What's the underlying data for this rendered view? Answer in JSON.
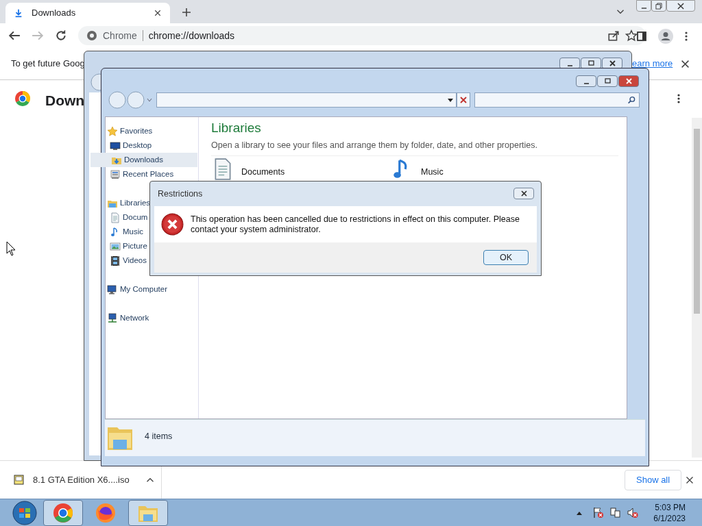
{
  "browser": {
    "tabs": [
      {
        "title": "Downloads",
        "selected": true
      }
    ],
    "address": {
      "site": "Chrome",
      "url": "chrome://downloads"
    },
    "info_bar": {
      "text": "To get future Goog",
      "link": "earn more"
    },
    "page_title": "Down",
    "download_shelf": {
      "items": [
        {
          "name": "8.1 GTA Edition X6....iso"
        }
      ],
      "show_all": "Show all"
    }
  },
  "explorer": {
    "sidebar": [
      {
        "label": "Favorites",
        "kind": "star",
        "selected": false,
        "children": [
          {
            "label": "Desktop",
            "kind": "desktop",
            "selected": false
          },
          {
            "label": "Downloads",
            "kind": "download",
            "selected": true
          },
          {
            "label": "Recent Places",
            "kind": "recent",
            "selected": false
          }
        ]
      },
      {
        "label": "Libraries",
        "kind": "library",
        "selected": false,
        "children": [
          {
            "label": "Docum",
            "kind": "document",
            "selected": false
          },
          {
            "label": "Music",
            "kind": "music",
            "selected": false
          },
          {
            "label": "Picture",
            "kind": "picture",
            "selected": false
          },
          {
            "label": "Videos",
            "kind": "video",
            "selected": false
          }
        ]
      },
      {
        "label": "My Computer",
        "kind": "computer",
        "selected": false
      },
      {
        "label": "Network",
        "kind": "network",
        "selected": false
      }
    ],
    "content": {
      "title": "Libraries",
      "description": "Open a library to see your files and arrange them by folder, date, and other properties.",
      "items": [
        {
          "name": "Documents",
          "kind": "document"
        },
        {
          "name": "Music",
          "kind": "music"
        }
      ]
    },
    "status": "4 items"
  },
  "dialog": {
    "title": "Restrictions",
    "message": "This operation has been cancelled due to restrictions in effect on this computer. Please contact your system administrator.",
    "buttons": [
      "OK"
    ]
  },
  "taskbar": {
    "apps": [
      {
        "kind": "chrome",
        "running": true
      },
      {
        "kind": "firefox",
        "running": false
      },
      {
        "kind": "explorer",
        "running": true
      }
    ],
    "time": "5:03 PM",
    "date": "6/1/2023"
  }
}
